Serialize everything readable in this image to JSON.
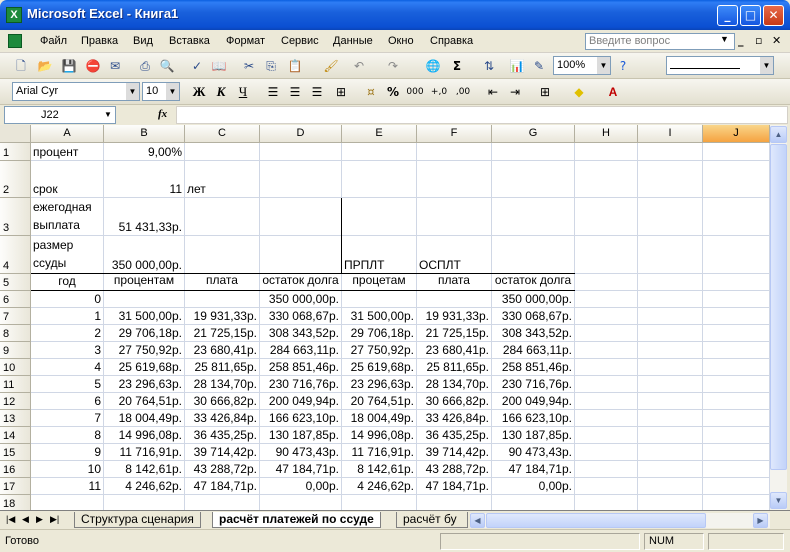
{
  "window": {
    "title": "Microsoft Excel - Книга1",
    "app_icon_letter": "X",
    "minimize": "_",
    "maximize": "□",
    "close": "✕"
  },
  "menu": {
    "items": [
      "Файл",
      "Правка",
      "Вид",
      "Вставка",
      "Формат",
      "Сервис",
      "Данные",
      "Окно",
      "Справка"
    ],
    "ask_placeholder": "Введите вопрос",
    "mdi_minimize": "_",
    "mdi_restore": "▫",
    "mdi_close": "✕"
  },
  "toolbar": {
    "zoom": "100%",
    "font_name": "Arial Cyr",
    "font_size": "10",
    "bold": "Ж",
    "italic": "К",
    "underline": "Ч",
    "percent": "%",
    "thousands": "000",
    "dec_inc": "+,0",
    "dec_dec": ",00"
  },
  "formula_bar": {
    "name_box": "J22",
    "fx": "fx",
    "content": ""
  },
  "sheet": {
    "columns": [
      "A",
      "B",
      "C",
      "D",
      "E",
      "F",
      "G",
      "H",
      "I",
      "J"
    ],
    "active_column": "J",
    "rows": [
      "1",
      "2",
      "3",
      "4",
      "5",
      "6",
      "7",
      "8",
      "9",
      "10",
      "11",
      "12",
      "13",
      "14",
      "15",
      "16",
      "17",
      "18"
    ],
    "cells": {
      "A1": "процент",
      "B1": "9,00%",
      "A2": "срок",
      "B2": "11",
      "C2": "лет",
      "A3": "ежегодная выплата",
      "B3": "51 431,33р.",
      "A4": "размер ссуды",
      "B4": "350 000,00р.",
      "E4": "ПРПЛТ",
      "F4": "ОСПЛТ",
      "A5": "год",
      "B5": "плата по процентам",
      "C5": "основная плата",
      "D5": "остаток долга",
      "E5": "плата по процетам",
      "F5": "основная плата",
      "G5": "остаток долга"
    },
    "table": [
      [
        "0",
        "",
        "",
        "350 000,00р.",
        "",
        "",
        "350 000,00р."
      ],
      [
        "1",
        "31 500,00р.",
        "19 931,33р.",
        "330 068,67р.",
        "31 500,00р.",
        "19 931,33р.",
        "330 068,67р."
      ],
      [
        "2",
        "29 706,18р.",
        "21 725,15р.",
        "308 343,52р.",
        "29 706,18р.",
        "21 725,15р.",
        "308 343,52р."
      ],
      [
        "3",
        "27 750,92р.",
        "23 680,41р.",
        "284 663,11р.",
        "27 750,92р.",
        "23 680,41р.",
        "284 663,11р."
      ],
      [
        "4",
        "25 619,68р.",
        "25 811,65р.",
        "258 851,46р.",
        "25 619,68р.",
        "25 811,65р.",
        "258 851,46р."
      ],
      [
        "5",
        "23 296,63р.",
        "28 134,70р.",
        "230 716,76р.",
        "23 296,63р.",
        "28 134,70р.",
        "230 716,76р."
      ],
      [
        "6",
        "20 764,51р.",
        "30 666,82р.",
        "200 049,94р.",
        "20 764,51р.",
        "30 666,82р.",
        "200 049,94р."
      ],
      [
        "7",
        "18 004,49р.",
        "33 426,84р.",
        "166 623,10р.",
        "18 004,49р.",
        "33 426,84р.",
        "166 623,10р."
      ],
      [
        "8",
        "14 996,08р.",
        "36 435,25р.",
        "130 187,85р.",
        "14 996,08р.",
        "36 435,25р.",
        "130 187,85р."
      ],
      [
        "9",
        "11 716,91р.",
        "39 714,42р.",
        "90 473,43р.",
        "11 716,91р.",
        "39 714,42р.",
        "90 473,43р."
      ],
      [
        "10",
        "8 142,61р.",
        "43 288,72р.",
        "47 184,71р.",
        "8 142,61р.",
        "43 288,72р.",
        "47 184,71р."
      ],
      [
        "11",
        "4 246,62р.",
        "47 184,71р.",
        "0,00р.",
        "4 246,62р.",
        "47 184,71р.",
        "0,00р."
      ]
    ]
  },
  "tabs": {
    "sheets": [
      "Структура сценария",
      "расчёт платежей по ссуде",
      "расчёт бу"
    ],
    "active": "расчёт платежей по ссуде"
  },
  "status": {
    "ready": "Готово",
    "num": "NUM"
  }
}
